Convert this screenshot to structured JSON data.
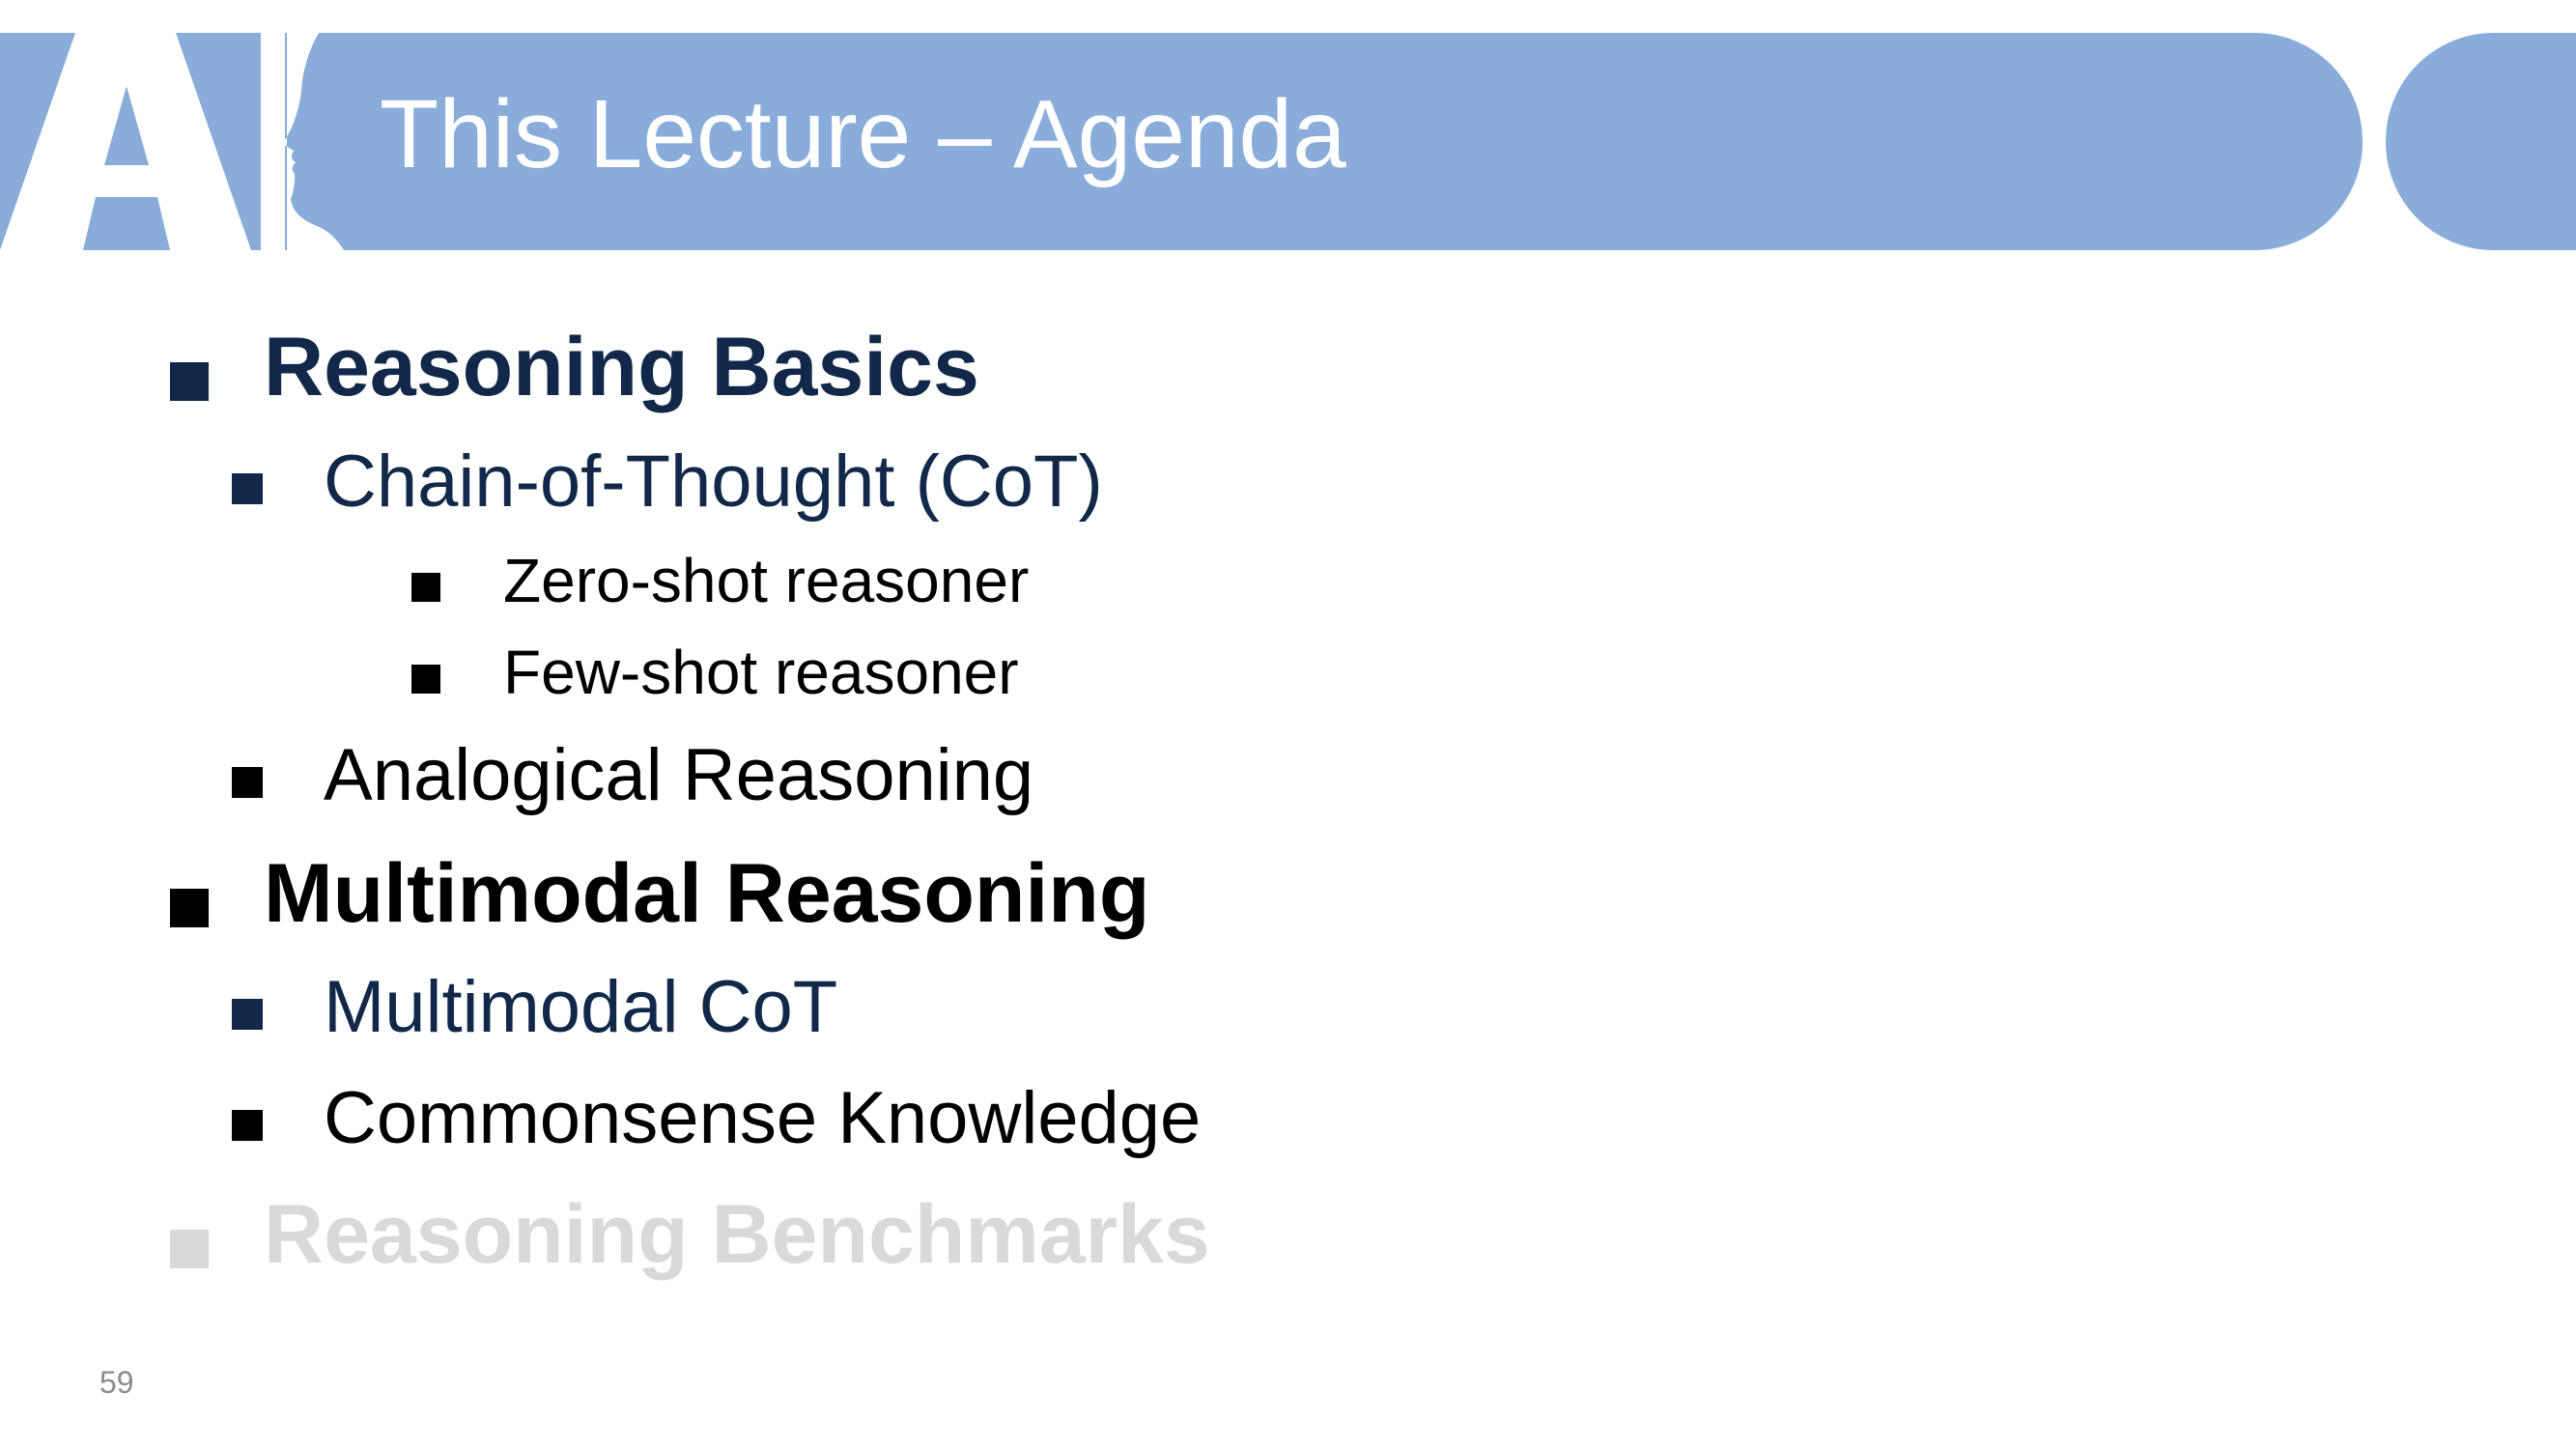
{
  "slide": {
    "title": "This Lecture – Agenda",
    "page_number": "59"
  },
  "colors": {
    "banner": "#89acda",
    "title_text": "#ffffff",
    "dark_navy": "#12284a",
    "black": "#000000",
    "muted_gray": "#d9d9d9",
    "page_number": "#8c8c8c"
  },
  "agenda": {
    "items": [
      {
        "label": "Reasoning Basics",
        "level": 1,
        "style": "navy"
      },
      {
        "label": "Chain-of-Thought (CoT)",
        "level": 2,
        "style": "navy"
      },
      {
        "label": "Zero-shot reasoner",
        "level": 3,
        "style": "black"
      },
      {
        "label": "Few-shot reasoner",
        "level": 3,
        "style": "black"
      },
      {
        "label": "Analogical Reasoning",
        "level": 2,
        "style": "black"
      },
      {
        "label": "Multimodal Reasoning",
        "level": 1,
        "style": "black"
      },
      {
        "label": "Multimodal CoT",
        "level": 2,
        "style": "navy"
      },
      {
        "label": "Commonsense Knowledge",
        "level": 2,
        "style": "black"
      },
      {
        "label": "Reasoning Benchmarks",
        "level": 1,
        "style": "muted"
      }
    ]
  }
}
